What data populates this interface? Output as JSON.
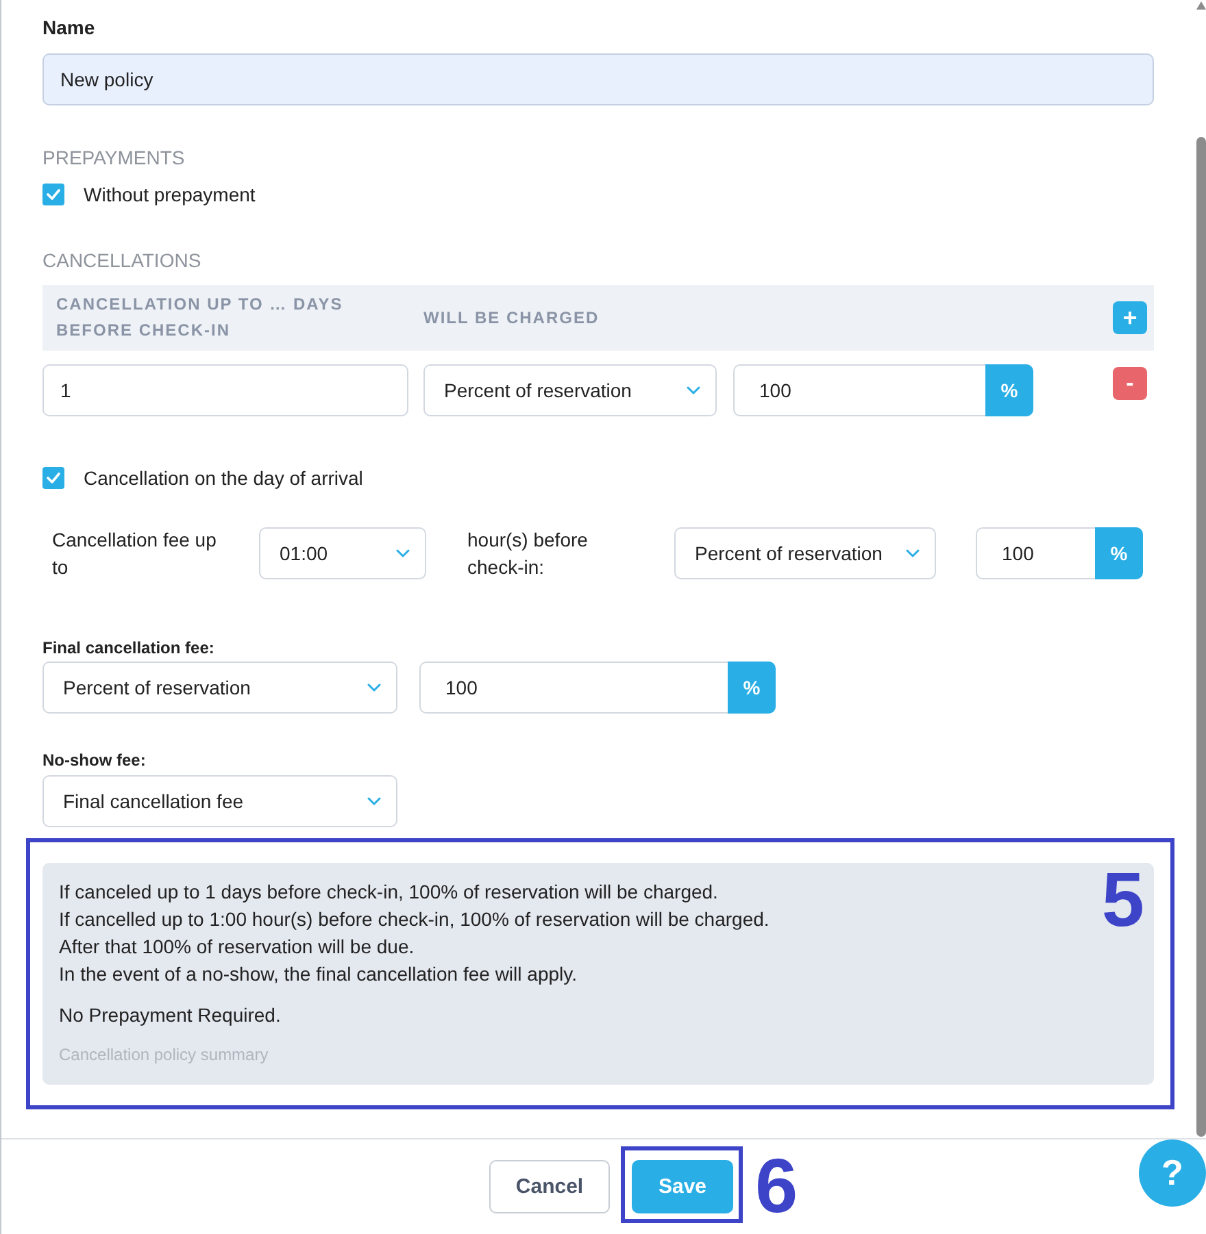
{
  "name_field": {
    "label": "Name",
    "value": "New policy"
  },
  "prepayments": {
    "heading": "PREPAYMENTS",
    "checkbox": {
      "label": "Without prepayment",
      "checked": true
    }
  },
  "cancellations": {
    "heading": "CANCELLATIONS",
    "table": {
      "columns": [
        "CANCELLATION UP TO … DAYS BEFORE CHECK-IN",
        "WILL BE CHARGED"
      ],
      "add_button": "+",
      "rows": [
        {
          "days": "1",
          "charge_type": "Percent of reservation",
          "amount": "100",
          "unit": "%",
          "remove_button": "-"
        }
      ]
    },
    "day_of_arrival": {
      "label": "Cancellation on the day of arrival",
      "checked": true,
      "fee_label": "Cancellation fee up to",
      "time": "01:00",
      "hours_label": "hour(s) before check-in:",
      "charge_type": "Percent of reservation",
      "amount": "100",
      "unit": "%"
    }
  },
  "final_fee": {
    "label": "Final cancellation fee:",
    "charge_type": "Percent of reservation",
    "amount": "100",
    "unit": "%"
  },
  "no_show_fee": {
    "label": "No-show fee:",
    "value": "Final cancellation fee"
  },
  "summary": {
    "callout": "5",
    "lines": [
      "If canceled up to 1 days before check-in, 100% of reservation will be charged.",
      "If cancelled up to 1:00 hour(s) before check-in, 100% of reservation will be charged.",
      "After that 100% of reservation will be due.",
      "In the event of a no-show, the final cancellation fee will apply."
    ],
    "note": "No Prepayment Required.",
    "caption": "Cancellation policy summary"
  },
  "footer": {
    "cancel": "Cancel",
    "save": {
      "label": "Save",
      "callout": "6"
    },
    "help": "?"
  }
}
